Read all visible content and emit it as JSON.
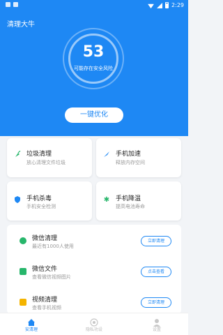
{
  "status_bar": {
    "time": "2:29"
  },
  "app": {
    "title": "清理大牛"
  },
  "gauge": {
    "score": "53",
    "description": "可能存在安全风险"
  },
  "optimize_button": "一键优化",
  "features": [
    {
      "title": "垃圾清理",
      "subtitle": "放心清理文件垃圾",
      "icon": "broom-icon"
    },
    {
      "title": "手机加速",
      "subtitle": "释放内存空间",
      "icon": "rocket-icon"
    },
    {
      "title": "手机杀毒",
      "subtitle": "手机安全检测",
      "icon": "shield-icon"
    },
    {
      "title": "手机降温",
      "subtitle": "提高电池寿命",
      "icon": "snowflake-icon"
    }
  ],
  "list": [
    {
      "title": "微信清理",
      "subtitle": "最近有1000人使用",
      "button": "立即清理",
      "icon": "wechat-icon"
    },
    {
      "title": "微信文件",
      "subtitle": "查看微信视频图片",
      "button": "点击查看",
      "icon": "folder-icon"
    },
    {
      "title": "视频清理",
      "subtitle": "查看手机视频",
      "button": "立即清理",
      "icon": "video-icon"
    }
  ],
  "bottom_nav": [
    {
      "label": "安清理",
      "active": true
    },
    {
      "label": "隐私功设",
      "active": false
    },
    {
      "label": "设置",
      "active": false
    }
  ],
  "colors": {
    "primary": "#1e88f4",
    "background": "#f2f4f7"
  }
}
